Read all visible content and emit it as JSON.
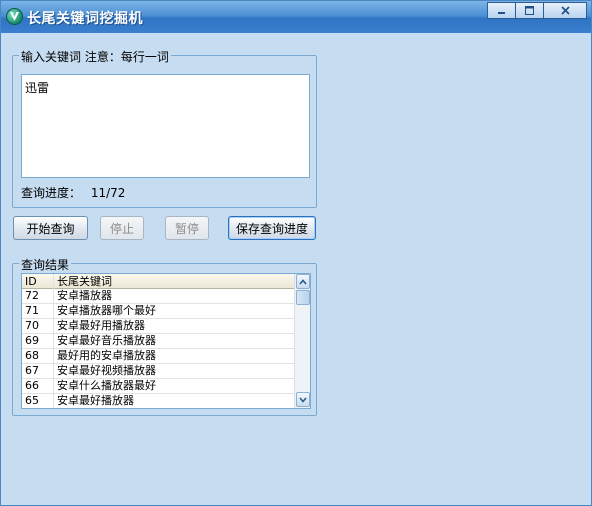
{
  "window": {
    "title": "长尾关键词挖掘机",
    "icon": "app-logo-icon",
    "controls": [
      "minimize-icon",
      "maximize-icon",
      "close-icon"
    ]
  },
  "input_group": {
    "legend": "输入关键词 注意：每行一词",
    "keywords_value": "迅雷",
    "progress_label": "查询进度：",
    "progress_value": "11/72"
  },
  "buttons": {
    "start": "开始查询",
    "stop": "停止",
    "pause": "暂停",
    "save": "保存查询进度"
  },
  "results_group": {
    "legend": "查询结果",
    "columns": [
      "ID",
      "长尾关键词"
    ],
    "rows": [
      {
        "id": "72",
        "keyword": "安卓播放器"
      },
      {
        "id": "71",
        "keyword": "安卓播放器哪个最好"
      },
      {
        "id": "70",
        "keyword": "安卓最好用播放器"
      },
      {
        "id": "69",
        "keyword": "安卓最好音乐播放器"
      },
      {
        "id": "68",
        "keyword": "最好用的安卓播放器"
      },
      {
        "id": "67",
        "keyword": "安卓最好视频播放器"
      },
      {
        "id": "66",
        "keyword": "安卓什么播放器最好"
      },
      {
        "id": "65",
        "keyword": "安卓最好播放器"
      }
    ]
  }
}
